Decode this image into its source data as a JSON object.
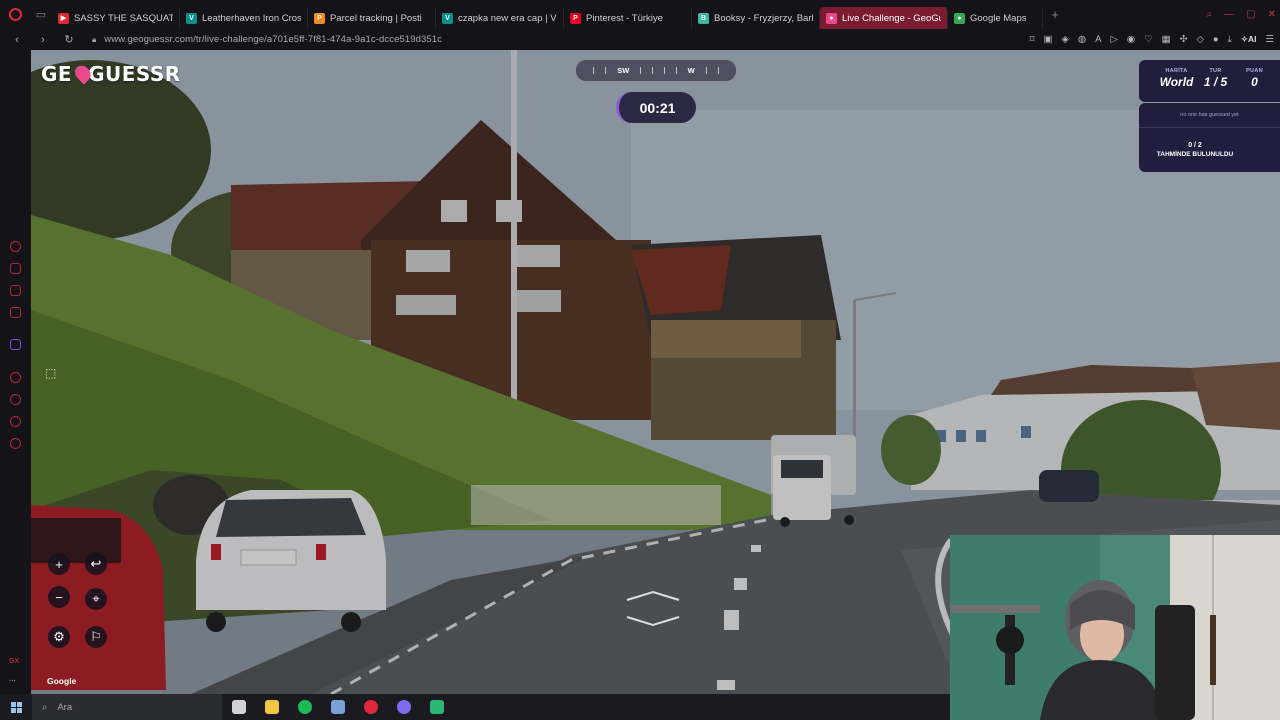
{
  "browser": {
    "tabs": [
      {
        "label": "SASSY THE SASQUATCH",
        "favicon_color": "#e0282f",
        "favicon_glyph": "▶"
      },
      {
        "label": "Leatherhaven Iron Cross",
        "favicon_color": "#0b8f8c",
        "favicon_glyph": "V"
      },
      {
        "label": "Parcel tracking | Posti",
        "favicon_color": "#f08a1d",
        "favicon_glyph": "P"
      },
      {
        "label": "czapka new era cap | Vint",
        "favicon_color": "#0b8f8c",
        "favicon_glyph": "V"
      },
      {
        "label": "Pinterest - Türkiye",
        "favicon_color": "#e60023",
        "favicon_glyph": "P"
      },
      {
        "label": "Booksy - Fryzjerzy, Barbe",
        "favicon_color": "#3ab5a6",
        "favicon_glyph": "B"
      },
      {
        "label": "Live Challenge - GeoGues",
        "favicon_color": "#e94a8a",
        "favicon_glyph": "●",
        "active": true
      },
      {
        "label": "Google Maps",
        "favicon_color": "#34a853",
        "favicon_glyph": "●"
      }
    ],
    "url": "www.geoguessr.com/tr/live-challenge/a701e5ff-7f81-474a-9a1c-dcce519d351c",
    "new_tab": "+",
    "sidebar_label": "GX"
  },
  "game": {
    "logo_left": "GE",
    "logo_right": "GUESSR",
    "compass": {
      "left": "SW",
      "right": "W"
    },
    "timer": "00:21",
    "hud": {
      "map_label": "HARİTA",
      "map_value": "World",
      "round_label": "TUR",
      "round_value": "1 / 5",
      "score_label": "PUAN",
      "score_value": "0"
    },
    "guess_note": "no one has guessed yet",
    "guess_count": "0 / 2",
    "guess_found": "TAHMİNDE BULUNULDU",
    "google_mark": "Google"
  },
  "taskbar": {
    "search_placeholder": "Ara",
    "apps": [
      {
        "name": "task-view",
        "color": "#cfd3da"
      },
      {
        "name": "file-explorer",
        "color": "#f4c542"
      },
      {
        "name": "spotify",
        "color": "#1db954"
      },
      {
        "name": "photo-app",
        "color": "#7aa0d8"
      },
      {
        "name": "opera-gx",
        "color": "#e0283a"
      },
      {
        "name": "discord-like",
        "color": "#7b6cf0"
      },
      {
        "name": "game-app",
        "color": "#2bb673"
      }
    ]
  }
}
